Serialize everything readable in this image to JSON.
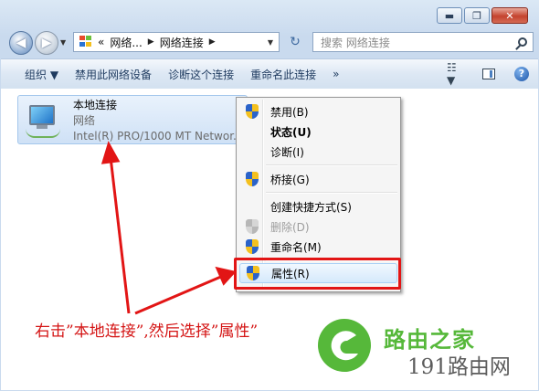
{
  "window": {
    "controls": {
      "minimize": "▬",
      "maximize": "❐",
      "close": "✕"
    }
  },
  "address": {
    "back_glyph": "◀",
    "forward_glyph": "▶",
    "prefix": "«",
    "seg1": "网络...",
    "sep": "▶",
    "seg2": "网络连接",
    "sep2": "▶",
    "dropdown": "▼",
    "refresh_glyph": "↻"
  },
  "search": {
    "placeholder": "搜索 网络连接"
  },
  "toolbar": {
    "items": [
      "组织 ▼",
      "禁用此网络设备",
      "诊断这个连接",
      "重命名此连接",
      "»"
    ],
    "view_glyph": "☷ ▼",
    "help_glyph": "?"
  },
  "connection": {
    "name": "本地连接",
    "network": "网络",
    "adapter": "Intel(R) PRO/1000 MT Networ..."
  },
  "context_menu": {
    "items": [
      {
        "label": "禁用(B)",
        "icon": "uac-shield-icon",
        "bold": false,
        "disabled": false
      },
      {
        "label": "状态(U)",
        "icon": "",
        "bold": true,
        "disabled": false
      },
      {
        "label": "诊断(I)",
        "icon": "",
        "bold": false,
        "disabled": false
      },
      {
        "label": "桥接(G)",
        "icon": "uac-shield-icon",
        "bold": false,
        "disabled": false
      },
      {
        "label": "创建快捷方式(S)",
        "icon": "",
        "bold": false,
        "disabled": false
      },
      {
        "label": "删除(D)",
        "icon": "uac-shield-icon",
        "bold": false,
        "disabled": true
      },
      {
        "label": "重命名(M)",
        "icon": "uac-shield-icon",
        "bold": false,
        "disabled": false
      },
      {
        "label": "属性(R)",
        "icon": "uac-shield-icon",
        "bold": false,
        "disabled": false,
        "highlighted": true
      }
    ]
  },
  "annotation": {
    "caption": "右击”本地连接”,然后选择”属性”",
    "color": "#e21515"
  },
  "watermark": {
    "title": "路由之家",
    "subtitle": "191路由网",
    "brand_color": "#56b83a"
  }
}
